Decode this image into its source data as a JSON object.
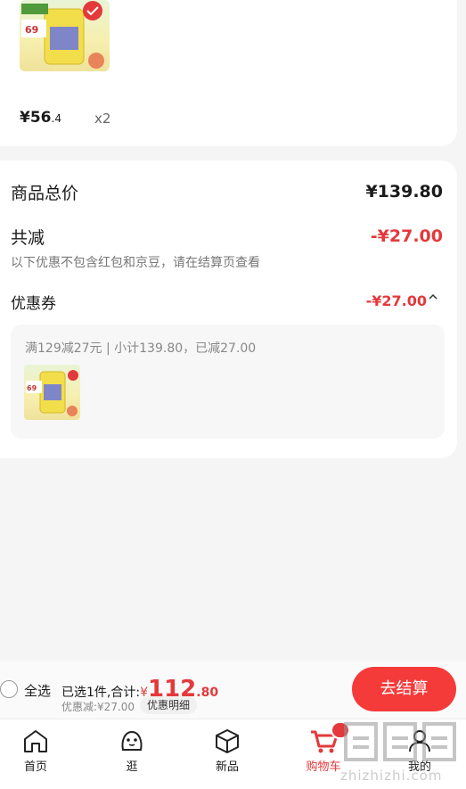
{
  "product": {
    "price_int": "¥56",
    "price_dec": ".4",
    "qty": "x2"
  },
  "summary": {
    "total_label": "商品总价",
    "total_value": "¥139.80",
    "reduce_label": "共减",
    "reduce_value": "-¥27.00",
    "reduce_note": "以下优惠不包含红包和京豆，请在结算页查看",
    "coupon_label": "优惠券",
    "coupon_value": "-¥27.00",
    "coupon_rule": "满129减27元 | 小计139.80，已减27.00"
  },
  "checkout": {
    "select_all": "全选",
    "selected_prefix": "已选1件,合计:",
    "total_yen": "¥",
    "total_int": "112",
    "total_dec": ".80",
    "discount": "优惠减:¥27.00",
    "detail_btn": "优惠明细",
    "checkout_btn": "去结算"
  },
  "tabbar": {
    "tabs": [
      {
        "label": "首页",
        "icon": "home-icon"
      },
      {
        "label": "逛",
        "icon": "browse-icon"
      },
      {
        "label": "新品",
        "icon": "cube-icon"
      },
      {
        "label": "购物车",
        "icon": "cart-icon",
        "active": true
      },
      {
        "label": "我的",
        "icon": "user-icon"
      }
    ]
  },
  "watermark": "zhizhizhi.com",
  "colors": {
    "accent": "#e4393c",
    "button": "#f53a3a"
  }
}
